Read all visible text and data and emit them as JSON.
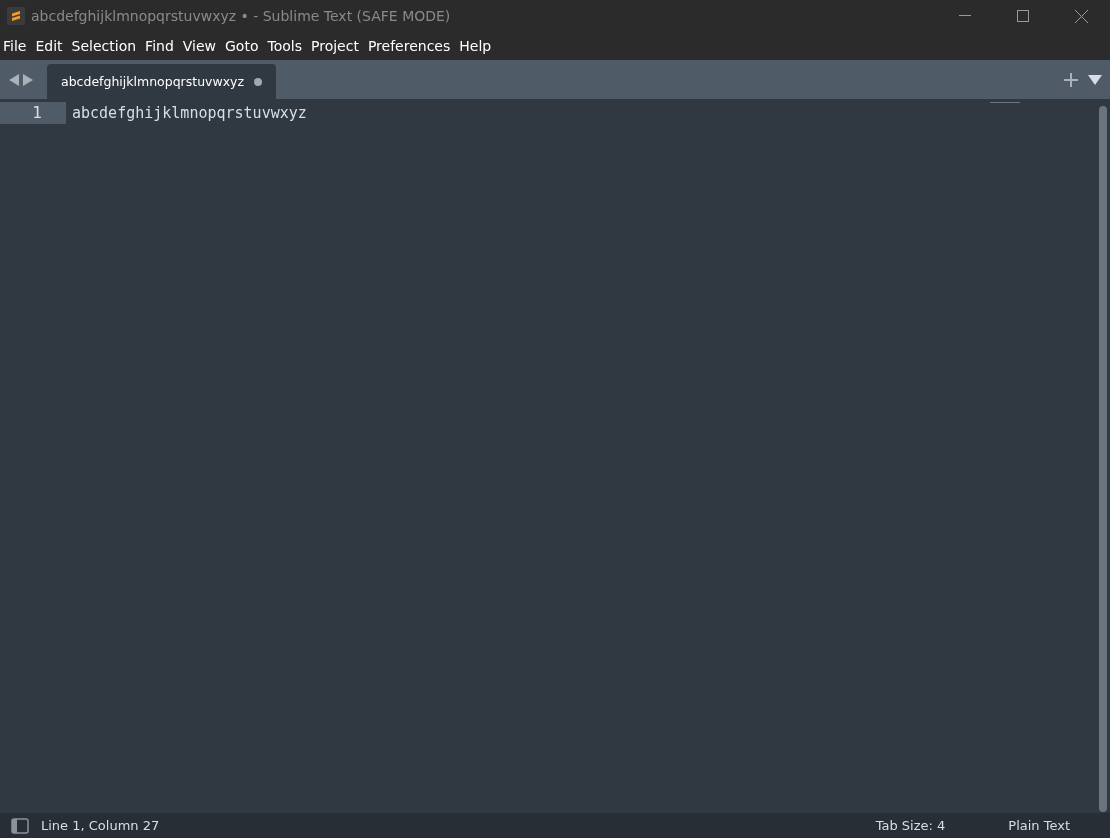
{
  "window": {
    "title": "abcdefghijklmnopqrstuvwxyz • - Sublime Text (SAFE MODE)"
  },
  "menu": [
    "File",
    "Edit",
    "Selection",
    "Find",
    "View",
    "Goto",
    "Tools",
    "Project",
    "Preferences",
    "Help"
  ],
  "tabs": [
    {
      "label": "abcdefghijklmnopqrstuvwxyz",
      "selected": true,
      "modified": true
    }
  ],
  "editor": {
    "lines": [
      {
        "number": "1",
        "text": "abcdefghijklmnopqrstuvwxyz",
        "current": true
      }
    ]
  },
  "status_bar": {
    "position": "Line 1, Column 27",
    "tab_size": "Tab Size: 4",
    "syntax": "Plain Text"
  }
}
